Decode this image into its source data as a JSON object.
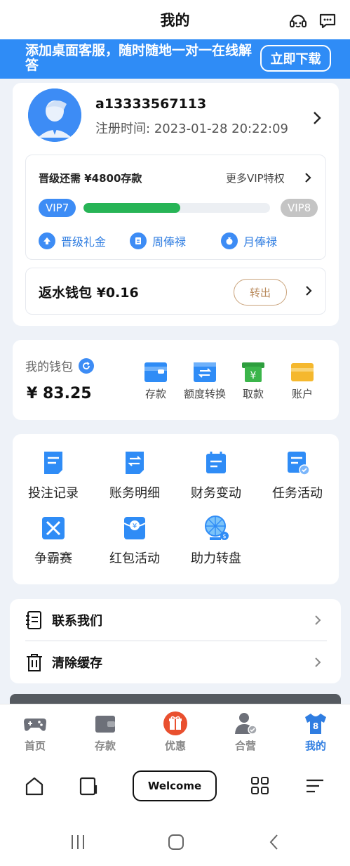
{
  "header": {
    "title": "我的",
    "icons": [
      "headset-icon",
      "chat-icon"
    ]
  },
  "banner": {
    "text": "添加桌面客服，随时随地一对一在线解答",
    "button": "立即下载"
  },
  "user": {
    "username": "a13333567113",
    "reg_label": "注册时间:",
    "reg_time": "2023-01-28 20:22:09"
  },
  "vip": {
    "upgrade_text": "晋级还需 ¥4800存款",
    "more_text": "更多VIP特权",
    "current": "VIP7",
    "next": "VIP8",
    "progress_percent": 52,
    "perks": [
      "晋级礼金",
      "周俸禄",
      "月俸禄"
    ]
  },
  "rebate": {
    "label": "返水钱包 ¥0.16",
    "button": "转出"
  },
  "wallet": {
    "label": "我的钱包",
    "amount": "¥ 83.25",
    "actions": [
      {
        "label": "存款",
        "color": "#2f8cf6"
      },
      {
        "label": "额度转换",
        "color": "#2f8cf6"
      },
      {
        "label": "取款",
        "color": "#3bb54a"
      },
      {
        "label": "账户",
        "color": "#f5b82e"
      }
    ]
  },
  "grid": {
    "items": [
      {
        "label": "投注记录",
        "icon": "bet-record-icon"
      },
      {
        "label": "账务明细",
        "icon": "account-detail-icon"
      },
      {
        "label": "财务变动",
        "icon": "finance-change-icon"
      },
      {
        "label": "任务活动",
        "icon": "task-icon"
      },
      {
        "label": "争霸赛",
        "icon": "tournament-icon"
      },
      {
        "label": "红包活动",
        "icon": "red-packet-icon"
      },
      {
        "label": "助力转盘",
        "icon": "wheel-icon"
      }
    ]
  },
  "list": {
    "contact": "联系我们",
    "clear_cache": "清除缓存"
  },
  "tabbar": {
    "items": [
      {
        "label": "首页",
        "icon": "gamepad-icon"
      },
      {
        "label": "存款",
        "icon": "wallet-icon"
      },
      {
        "label": "优惠",
        "icon": "gift-icon"
      },
      {
        "label": "合营",
        "icon": "partner-icon"
      },
      {
        "label": "我的",
        "icon": "jersey-icon"
      }
    ],
    "active_index": 4,
    "jersey_number": "8"
  },
  "browser": {
    "welcome": "Welcome"
  },
  "colors": {
    "primary": "#2f8cf6",
    "progress": "#27b456",
    "gift": "#e9502f",
    "rebate_btn": "#b98a5c"
  }
}
